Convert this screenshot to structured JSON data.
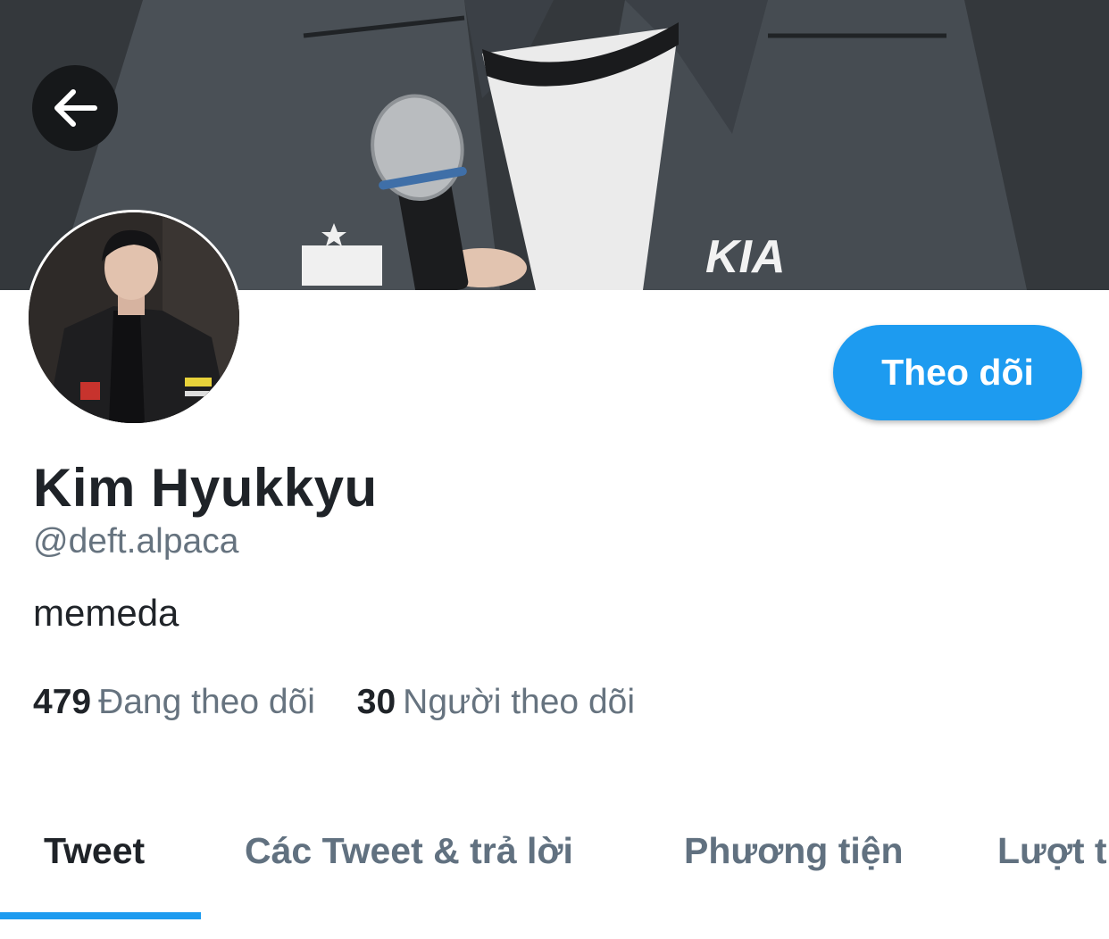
{
  "banner": {
    "image": "profile-banner-photo"
  },
  "back_button": {
    "icon": "arrow-left-icon"
  },
  "avatar": {
    "image": "profile-avatar-photo"
  },
  "follow_button": {
    "label": "Theo dõi",
    "color": "#1d9bf0"
  },
  "profile": {
    "display_name": "Kim Hyukkyu",
    "handle": "@deft.alpaca",
    "bio": "memeda"
  },
  "stats": {
    "following_count": "479",
    "following_label": "Đang theo dõi",
    "followers_count": "30",
    "followers_label": "Người theo dõi"
  },
  "tabs": [
    {
      "label": "Tweet",
      "active": true
    },
    {
      "label": "Các Tweet & trả lời",
      "active": false
    },
    {
      "label": "Phương tiện",
      "active": false
    },
    {
      "label": "Lượt t",
      "active": false
    }
  ],
  "colors": {
    "accent": "#1d9bf0",
    "text_primary": "#1f2328",
    "text_secondary": "#66737f"
  }
}
